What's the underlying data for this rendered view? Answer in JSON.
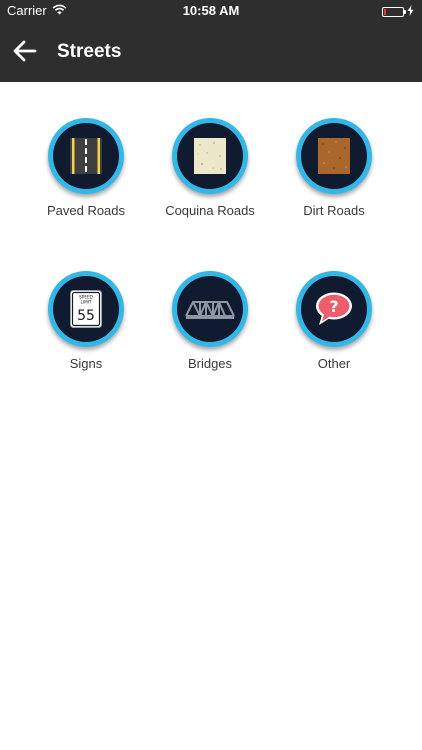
{
  "status_bar": {
    "carrier": "Carrier",
    "time": "10:58 AM"
  },
  "nav": {
    "title": "Streets",
    "back_icon": "arrow-left-icon"
  },
  "categories": [
    {
      "label": "Paved Roads",
      "icon": "paved-road-icon"
    },
    {
      "label": "Coquina Roads",
      "icon": "coquina-road-icon"
    },
    {
      "label": "Dirt Roads",
      "icon": "dirt-road-icon"
    },
    {
      "label": "Signs",
      "icon": "speed-limit-sign-icon",
      "sign_top": "SPEED",
      "sign_mid": "LIMIT",
      "sign_value": "55"
    },
    {
      "label": "Bridges",
      "icon": "bridge-icon"
    },
    {
      "label": "Other",
      "icon": "question-bubble-icon",
      "glyph": "?"
    }
  ],
  "colors": {
    "header_bg": "#2e2e2e",
    "ring": "#33b7e6",
    "circle_fill": "#101b30",
    "battery_low": "#e23b3b",
    "bubble": "#ef5d6c"
  }
}
